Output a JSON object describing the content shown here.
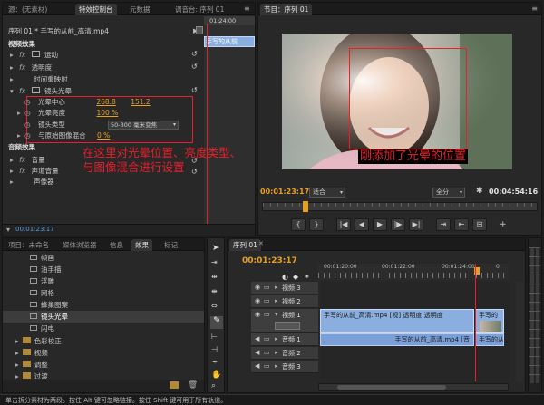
{
  "effect_controls": {
    "tabs": [
      "源：(无素材)",
      "特效控制台",
      "元数据",
      "调音台: 序列 01"
    ],
    "seq_label": "序列 01 * 手写的从前_高清.mp4",
    "timecode_ruler": "01:24:00",
    "clip_label": "手写的从前",
    "video_section": "视频效果",
    "items": [
      {
        "name": "运动",
        "fx": "fx"
      },
      {
        "name": "透明度",
        "fx": "fx"
      },
      {
        "name": "时间重映射",
        "fx": ""
      },
      {
        "name": "镜头光晕",
        "fx": "fx"
      }
    ],
    "lens_flare": {
      "center_label": "光晕中心",
      "center_x": "268.8",
      "center_y": "151.2",
      "brightness_label": "光晕亮度",
      "brightness": "100 %",
      "type_label": "镜头类型",
      "type_value": "50-300 毫米变焦",
      "blend_label": "与原始图像混合",
      "blend": "0 %"
    },
    "audio_section": "音频效果",
    "audio_items": [
      {
        "name": "音量",
        "fx": "fx"
      },
      {
        "name": "声道音量",
        "fx": "fx"
      },
      {
        "name": "声像器",
        "fx": ""
      }
    ],
    "annotation": "在这里对光晕位置、亮度类型、与图像混合进行设置",
    "timecode": "00:01:23:17"
  },
  "program_monitor": {
    "tab": "节目：序列 01",
    "annotation": "刚添加了光晕的位置",
    "timecode_left": "00:01:23:17",
    "fit": "适合",
    "quality": "全分",
    "timecode_right": "00:04:54:16",
    "transport": [
      "{",
      "}",
      "|◀",
      "◀|",
      "◀",
      "▶",
      "|▶",
      "▶|",
      "⇥",
      "⇤",
      "⊟",
      "▣",
      "◉"
    ]
  },
  "project": {
    "tabs": [
      "项目：未命名",
      "媒体浏览器",
      "信息",
      "效果",
      "标记"
    ],
    "items": [
      "帧画",
      "油手描",
      "浮雕",
      "网格",
      "蜂巢图案",
      "镜头光晕",
      "闪电"
    ],
    "folders": [
      "色彩校正",
      "视频",
      "调整",
      "过渡"
    ]
  },
  "timeline": {
    "tab": "序列 01",
    "timecode": "00:01:23:17",
    "ruler": [
      "00:01:20:00",
      "00:01:22:00",
      "00:01:24:00"
    ],
    "tracks": [
      {
        "name": "视频 3",
        "type": "video"
      },
      {
        "name": "视频 2",
        "type": "video"
      },
      {
        "name": "视频 1",
        "type": "video"
      },
      {
        "name": "音频 1",
        "type": "audio"
      },
      {
        "name": "音频 2",
        "type": "audio"
      },
      {
        "name": "音频 3",
        "type": "audio"
      }
    ],
    "video_clip": "手写的从前_高清.mp4 [视] 透明度:透明度",
    "video_clip2": "手写的",
    "audio_clip": "手写的从前_高清.mp4 [音",
    "audio_clip2": "手写的从"
  },
  "status_bar": "单击拆分素材为两段。按住 Alt 键可忽略链接。按住 Shift 键可用于所有轨道。",
  "colors": {
    "accent": "#e8a020",
    "annotation": "#e8202a",
    "clip_blue": "#8aaee0",
    "clip_audio": "#7b9fd8"
  }
}
